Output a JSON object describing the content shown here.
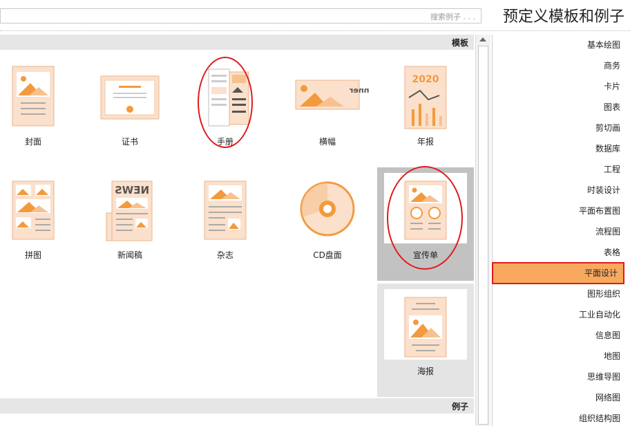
{
  "header": {
    "title": "预定义模板和例子",
    "search_placeholder": "搜索例子 . . ."
  },
  "sections": {
    "templates": "模板",
    "examples": "例子"
  },
  "categories": [
    "基本绘图",
    "商务",
    "卡片",
    "图表",
    "剪切画",
    "数据库",
    "工程",
    "时装设计",
    "平面布置图",
    "流程图",
    "表格",
    "平面设计",
    "图形组织",
    "工业自动化",
    "信息图",
    "地图",
    "思维导图",
    "网络图",
    "组织结构图"
  ],
  "selected_category": "平面设计",
  "templates": [
    {
      "id": "annual",
      "label": "年报",
      "year": "2020"
    },
    {
      "id": "banner",
      "label": "横幅",
      "banner_text": "Banner"
    },
    {
      "id": "brochure",
      "label": "手册"
    },
    {
      "id": "certificate",
      "label": "证书"
    },
    {
      "id": "cover",
      "label": "封面"
    },
    {
      "id": "flyer",
      "label": "宣传单"
    },
    {
      "id": "cd",
      "label": "CD盘面"
    },
    {
      "id": "magazine",
      "label": "杂志"
    },
    {
      "id": "newsletter",
      "label": "新闻稿",
      "news_text": "NEWS"
    },
    {
      "id": "collage",
      "label": "拼图"
    },
    {
      "id": "poster",
      "label": "海报"
    }
  ],
  "colors": {
    "accent": "#f7a35c",
    "orange": "#f39a3d",
    "peach": "#fbe0cb",
    "selected_bg": "#f8a95e",
    "annotation_red": "#e0191b"
  }
}
